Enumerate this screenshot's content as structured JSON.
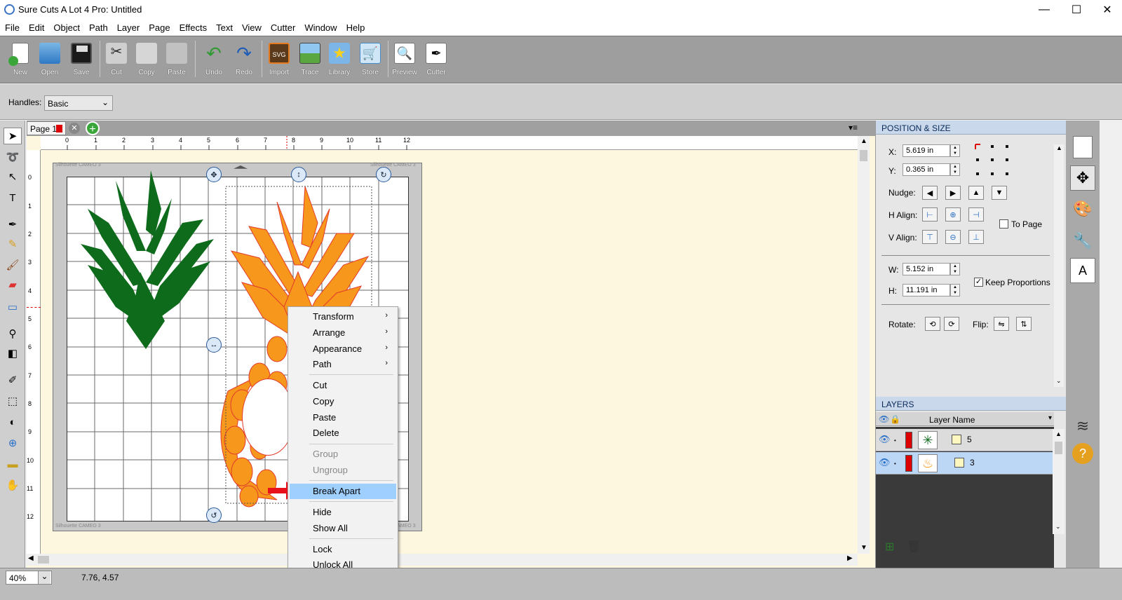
{
  "window": {
    "title": "Sure Cuts A Lot 4 Pro: Untitled",
    "minimize": "—",
    "maximize": "☐",
    "close": "✕"
  },
  "menu": [
    "File",
    "Edit",
    "Object",
    "Path",
    "Layer",
    "Page",
    "Effects",
    "Text",
    "View",
    "Cutter",
    "Window",
    "Help"
  ],
  "toolbar": {
    "new": "New",
    "open": "Open",
    "save": "Save",
    "cut": "Cut",
    "copy": "Copy",
    "paste": "Paste",
    "undo": "Undo",
    "redo": "Redo",
    "import": "Import",
    "trace": "Trace",
    "library": "Library",
    "store": "Store",
    "preview": "Preview",
    "cutter": "Cutter"
  },
  "options": {
    "handles_label": "Handles:",
    "handles_value": "Basic"
  },
  "page_tab": {
    "label": "Page 1"
  },
  "ruler": {
    "h": [
      "0",
      "1",
      "2",
      "3",
      "4",
      "5",
      "6",
      "7",
      "8",
      "9",
      "10",
      "11",
      "12"
    ],
    "v": [
      "0",
      "1",
      "2",
      "3",
      "4",
      "5",
      "6",
      "7",
      "8",
      "9",
      "10",
      "11",
      "12"
    ]
  },
  "mat": {
    "label": "Silhouette CAMEO 3"
  },
  "context_menu": {
    "transform": "Transform",
    "arrange": "Arrange",
    "appearance": "Appearance",
    "path": "Path",
    "cut": "Cut",
    "copy": "Copy",
    "paste": "Paste",
    "delete": "Delete",
    "group": "Group",
    "ungroup": "Ungroup",
    "break_apart": "Break Apart",
    "hide": "Hide",
    "show_all": "Show All",
    "lock": "Lock",
    "unlock_all": "Unlock All"
  },
  "position_size": {
    "header": "POSITION & SIZE",
    "x_label": "X:",
    "x_value": "5.619 in",
    "y_label": "Y:",
    "y_value": "0.365 in",
    "nudge_label": "Nudge:",
    "halign_label": "H Align:",
    "valign_label": "V Align:",
    "to_page": "To Page",
    "w_label": "W:",
    "w_value": "5.152 in",
    "h_label": "H:",
    "h_value": "11.191 in",
    "keep_proportions": "Keep Proportions",
    "rotate_label": "Rotate:",
    "flip_label": "Flip:"
  },
  "layers": {
    "header": "LAYERS",
    "column": "Layer Name",
    "rows": [
      {
        "name": "5"
      },
      {
        "name": "3"
      }
    ]
  },
  "status": {
    "zoom": "40%",
    "coords": "7.76, 4.57"
  },
  "colors": {
    "green": "#0f6b1c",
    "orange": "#f7981d",
    "accent": "#2a70c8",
    "selected": "#9fcfff"
  }
}
